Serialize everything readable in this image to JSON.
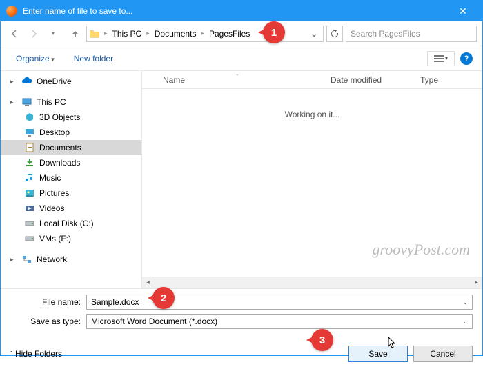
{
  "window": {
    "title": "Enter name of file to save to...",
    "close_glyph": "✕"
  },
  "nav": {
    "breadcrumb": [
      "This PC",
      "Documents",
      "PagesFiles"
    ],
    "search_placeholder": "Search PagesFiles"
  },
  "toolbar": {
    "organize": "Organize",
    "new_folder": "New folder",
    "help": "?"
  },
  "tree": {
    "items": [
      {
        "label": "OneDrive",
        "icon": "cloud",
        "level": 1
      },
      {
        "spacer": true
      },
      {
        "label": "This PC",
        "icon": "pc",
        "level": 1
      },
      {
        "label": "3D Objects",
        "icon": "3d",
        "level": 2
      },
      {
        "label": "Desktop",
        "icon": "desktop",
        "level": 2
      },
      {
        "label": "Documents",
        "icon": "docs",
        "level": 2,
        "selected": true
      },
      {
        "label": "Downloads",
        "icon": "downloads",
        "level": 2
      },
      {
        "label": "Music",
        "icon": "music",
        "level": 2
      },
      {
        "label": "Pictures",
        "icon": "pictures",
        "level": 2
      },
      {
        "label": "Videos",
        "icon": "videos",
        "level": 2
      },
      {
        "label": "Local Disk (C:)",
        "icon": "disk",
        "level": 2
      },
      {
        "label": "VMs (F:)",
        "icon": "disk",
        "level": 2
      },
      {
        "spacer": true
      },
      {
        "label": "Network",
        "icon": "network",
        "level": 1
      }
    ]
  },
  "list": {
    "col_name": "Name",
    "col_date": "Date modified",
    "col_type": "Type",
    "status_text": "Working on it..."
  },
  "form": {
    "filename_label": "File name:",
    "filename_value": "Sample.docx",
    "type_label": "Save as type:",
    "type_value": "Microsoft Word Document (*.docx)"
  },
  "buttons": {
    "hide_folders": "Hide Folders",
    "save": "Save",
    "cancel": "Cancel"
  },
  "callouts": {
    "c1": "1",
    "c2": "2",
    "c3": "3"
  },
  "watermark": "groovyPost.com"
}
